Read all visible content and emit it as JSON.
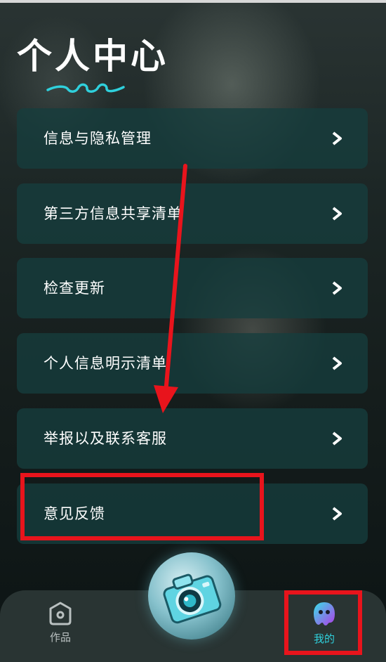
{
  "header": {
    "title": "个人中心"
  },
  "menu": {
    "items": [
      {
        "label": "信息与隐私管理"
      },
      {
        "label": "第三方信息共享清单"
      },
      {
        "label": "检查更新"
      },
      {
        "label": "个人信息明示清单"
      },
      {
        "label": "举报以及联系客服"
      },
      {
        "label": "意见反馈"
      }
    ]
  },
  "nav": {
    "works_label": "作品",
    "mine_label": "我的"
  },
  "colors": {
    "accent": "#2fd0dc",
    "annotation": "#e8141c",
    "card_bg": "#163e3e"
  },
  "icons": {
    "chevron": "chevron-right-icon",
    "works": "works-icon",
    "mine": "ghost-avatar-icon",
    "camera": "camera-icon"
  }
}
